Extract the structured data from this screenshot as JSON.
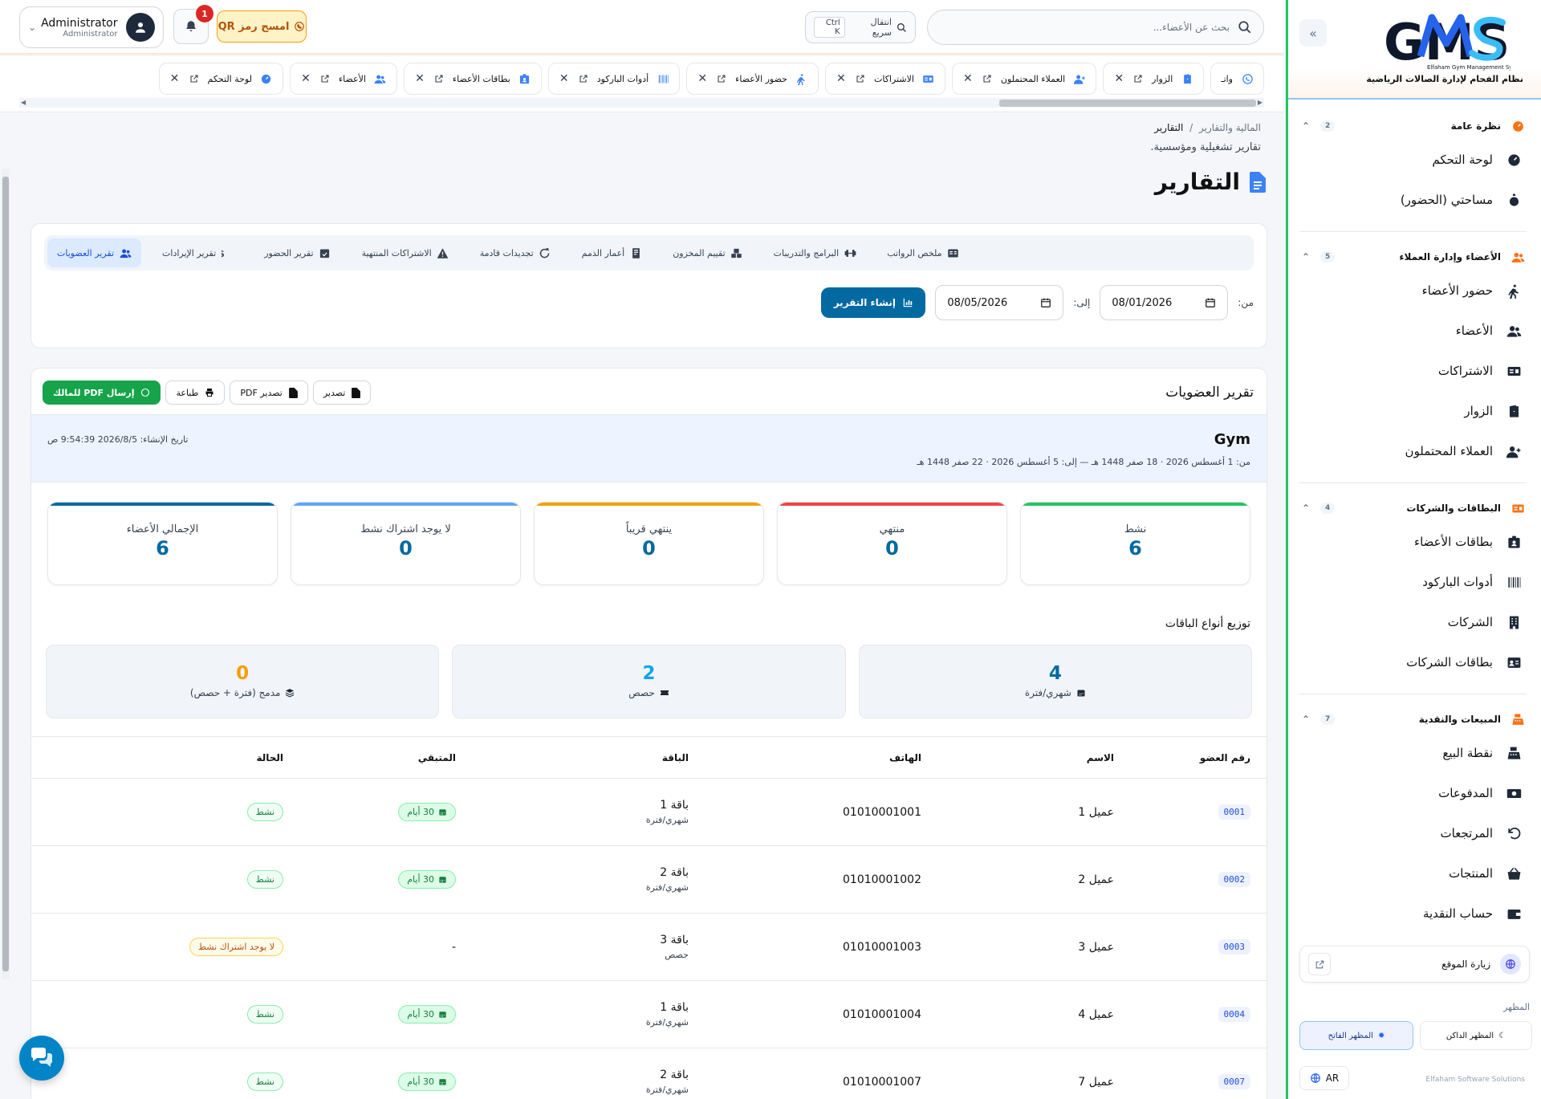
{
  "sidebar": {
    "logo_text": "GMS",
    "logo_tagline": "Elfaham Gym Management System",
    "logo_sub": "نظام الفحام لإدارة الصالات الرياضية",
    "groups": [
      {
        "title": "نظرة عامة",
        "count": "2",
        "items": [
          {
            "label": "لوحة التحكم",
            "icon": "dashboard-icon"
          },
          {
            "label": "مساحتي (الحضور)",
            "icon": "stopwatch-icon"
          }
        ]
      },
      {
        "title": "الأعضاء وإدارة العملاء",
        "count": "5",
        "items": [
          {
            "label": "حضور الأعضاء",
            "icon": "walking-icon"
          },
          {
            "label": "الأعضاء",
            "icon": "users-icon"
          },
          {
            "label": "الاشتراكات",
            "icon": "id-card-icon"
          },
          {
            "label": "الزوار",
            "icon": "door-icon"
          },
          {
            "label": "العملاء المحتملون",
            "icon": "user-plus-icon"
          }
        ]
      },
      {
        "title": "البطاقات والشركات",
        "count": "4",
        "items": [
          {
            "label": "بطاقات الأعضاء",
            "icon": "badge-icon"
          },
          {
            "label": "أدوات الباركود",
            "icon": "barcode-icon"
          },
          {
            "label": "الشركات",
            "icon": "building-icon"
          },
          {
            "label": "بطاقات الشركات",
            "icon": "address-card-icon"
          }
        ]
      },
      {
        "title": "المبيعات والنقدية",
        "count": "7",
        "items": [
          {
            "label": "نقطة البيع",
            "icon": "cash-register-icon"
          },
          {
            "label": "المدفوعات",
            "icon": "money-icon"
          },
          {
            "label": "المرتجعات",
            "icon": "undo-icon"
          },
          {
            "label": "المنتجات",
            "icon": "basket-icon"
          },
          {
            "label": "حساب النقدية",
            "icon": "wallet-icon"
          }
        ]
      }
    ],
    "visit_site": "زيارة الموقع",
    "theme_label": "المظهر",
    "theme_dark": "المظهر الداكن",
    "theme_light": "المظهر الفاتح",
    "lang": "AR",
    "footer": "Elfaham Software Solutions"
  },
  "topbar": {
    "search_placeholder": "بحث عن الأعضاء...",
    "quick_label": "انتقال سريع",
    "quick_kbd": "Ctrl K",
    "qr_label": "امسح رمز QR",
    "notifications": "1",
    "user_name": "Administrator",
    "user_role": "Administrator"
  },
  "tabs": [
    {
      "label": "لوحة التحكم",
      "icon": "dashboard-icon"
    },
    {
      "label": "الأعضاء",
      "icon": "users-icon"
    },
    {
      "label": "بطاقات الأعضاء",
      "icon": "badge-icon"
    },
    {
      "label": "أدوات الباركود",
      "icon": "barcode-icon"
    },
    {
      "label": "حضور الأعضاء",
      "icon": "walking-icon"
    },
    {
      "label": "الاشتراكات",
      "icon": "id-card-icon"
    },
    {
      "label": "العملاء المحتملون",
      "icon": "user-plus-icon"
    },
    {
      "label": "الزوار",
      "icon": "door-icon"
    },
    {
      "label": "واتـ",
      "icon": "whatsapp-icon"
    }
  ],
  "breadcrumb": {
    "parent": "المالية والتقارير",
    "separator": "/",
    "current": "التقارير"
  },
  "page_subtitle": "تقارير تشغيلية ومؤسسية.",
  "page_title": "التقارير",
  "report_tabs": [
    {
      "label": "تقرير العضويات",
      "icon": "users-icon",
      "active": true
    },
    {
      "label": "تقرير الإيرادات",
      "icon": "dollar-icon"
    },
    {
      "label": "تقرير الحضور",
      "icon": "calendar-check-icon"
    },
    {
      "label": "الاشتراكات المنتهية",
      "icon": "warning-icon"
    },
    {
      "label": "تجديدات قادمة",
      "icon": "refresh-icon"
    },
    {
      "label": "أعمار الذمم",
      "icon": "invoice-icon"
    },
    {
      "label": "تقييم المخزون",
      "icon": "boxes-icon"
    },
    {
      "label": "البرامج والتدريبات",
      "icon": "dumbbell-icon"
    },
    {
      "label": "ملخص الرواتب",
      "icon": "payroll-icon"
    }
  ],
  "filters": {
    "from_label": "من:",
    "from_value": "08/01/2026",
    "to_label": "إلى:",
    "to_value": "08/05/2026",
    "generate": "إنشاء التقرير"
  },
  "report": {
    "title": "تقرير العضويات",
    "actions": {
      "export": "تصدير",
      "export_pdf": "تصدير PDF",
      "print": "طباعة",
      "send_pdf": "إرسال PDF للمالك"
    },
    "gym_name": "Gym",
    "range": "من: 1 أغسطس 2026 · 18 صفر 1448 هـ — إلى: 5 أغسطس 2026 · 22 صفر 1448 هـ",
    "created": "تاريخ الإنشاء: 2026/8/5 9:54:39 ص",
    "kpis": [
      {
        "label": "نشط",
        "value": "6",
        "color": "#22c55e"
      },
      {
        "label": "منتهي",
        "value": "0",
        "color": "#ef4444"
      },
      {
        "label": "ينتهي قريباً",
        "value": "0",
        "color": "#f59e0b"
      },
      {
        "label": "لا يوجد اشتراك نشط",
        "value": "0",
        "color": "#60a5fa"
      },
      {
        "label": "الإجمالي الأعضاء",
        "value": "6",
        "color": "#0369a1"
      }
    ],
    "dist_title": "توزيع أنواع الباقات",
    "dists": [
      {
        "label": "شهري/فترة",
        "value": "4",
        "color": "#0369a1",
        "icon": "calendar-icon"
      },
      {
        "label": "حصص",
        "value": "2",
        "color": "#0ea5e9",
        "icon": "ticket-icon"
      },
      {
        "label": "مدمج (فترة + حصص)",
        "value": "0",
        "color": "#f59e0b",
        "icon": "layers-icon"
      }
    ],
    "columns": [
      "رقم العضو",
      "الاسم",
      "الهاتف",
      "الباقة",
      "المتبقي",
      "الحالة"
    ],
    "rows": [
      {
        "id": "0001",
        "name": "عميل 1",
        "phone": "01010001001",
        "package": "باقة 1",
        "type": "شهري/فترة",
        "remaining": "30 أيام",
        "status": "نشط",
        "status_kind": "active"
      },
      {
        "id": "0002",
        "name": "عميل 2",
        "phone": "01010001002",
        "package": "باقة 2",
        "type": "شهري/فترة",
        "remaining": "30 أيام",
        "status": "نشط",
        "status_kind": "active"
      },
      {
        "id": "0003",
        "name": "عميل 3",
        "phone": "01010001003",
        "package": "باقة 3",
        "type": "حصص",
        "remaining": "-",
        "status": "لا يوجد اشتراك نشط",
        "status_kind": "none"
      },
      {
        "id": "0004",
        "name": "عميل 4",
        "phone": "01010001004",
        "package": "باقة 1",
        "type": "شهري/فترة",
        "remaining": "30 أيام",
        "status": "نشط",
        "status_kind": "active"
      },
      {
        "id": "0007",
        "name": "عميل 7",
        "phone": "01010001007",
        "package": "باقة 2",
        "type": "شهري/فترة",
        "remaining": "30 أيام",
        "status": "نشط",
        "status_kind": "active"
      }
    ]
  }
}
